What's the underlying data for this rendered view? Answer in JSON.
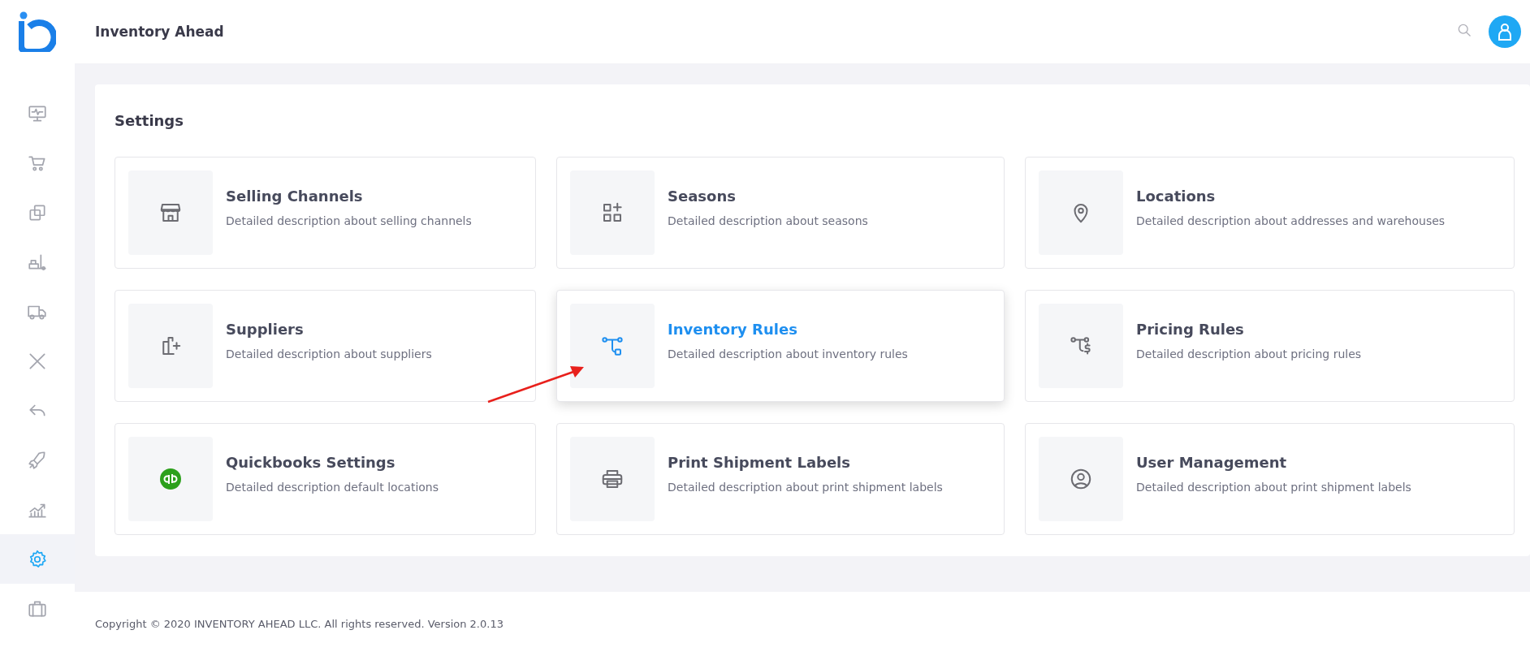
{
  "header": {
    "title": "Inventory Ahead"
  },
  "sidebar": {
    "items": [
      {
        "selected": false
      },
      {
        "selected": false
      },
      {
        "selected": false
      },
      {
        "selected": false
      },
      {
        "selected": false
      },
      {
        "selected": false
      },
      {
        "selected": false
      },
      {
        "selected": false
      },
      {
        "selected": false
      },
      {
        "selected": true
      },
      {
        "selected": false
      }
    ]
  },
  "page": {
    "title": "Settings",
    "cards": [
      {
        "title": "Selling Channels",
        "description": "Detailed description about selling channels",
        "selected": false
      },
      {
        "title": "Seasons",
        "description": "Detailed description about seasons",
        "selected": false
      },
      {
        "title": "Locations",
        "description": "Detailed description about addresses and warehouses",
        "selected": false
      },
      {
        "title": "Suppliers",
        "description": "Detailed description about suppliers",
        "selected": false
      },
      {
        "title": "Inventory Rules",
        "description": "Detailed description about inventory rules",
        "selected": true
      },
      {
        "title": "Pricing Rules",
        "description": "Detailed description about pricing rules",
        "selected": false
      },
      {
        "title": "Quickbooks Settings",
        "description": "Detailed description default locations",
        "selected": false
      },
      {
        "title": "Print Shipment Labels",
        "description": "Detailed description about print shipment labels",
        "selected": false
      },
      {
        "title": "User Management",
        "description": "Detailed description about print shipment labels",
        "selected": false
      }
    ]
  },
  "footer": {
    "text": "Copyright © 2020 INVENTORY AHEAD LLC. All rights reserved. Version 2.0.13"
  }
}
